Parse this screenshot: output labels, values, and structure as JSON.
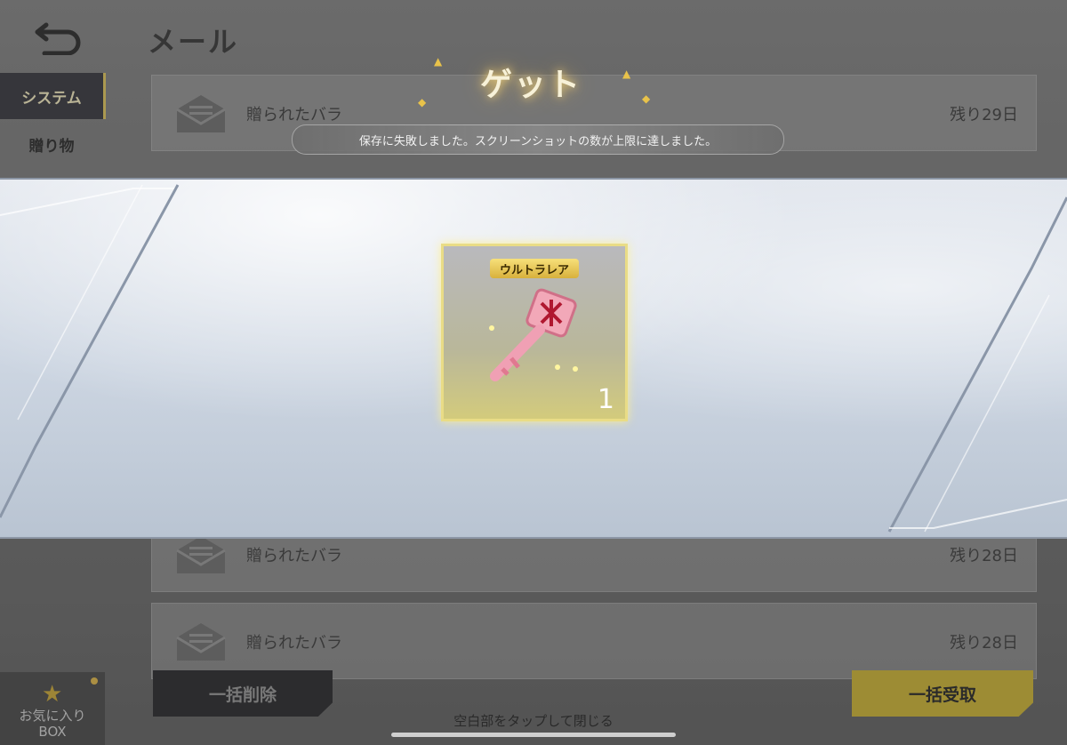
{
  "header": {
    "title": "メール"
  },
  "sidebar": {
    "tabs": [
      {
        "label": "システム",
        "active": true
      },
      {
        "label": "贈り物",
        "active": false
      }
    ],
    "favorite": {
      "line1": "お気に入り",
      "line2": "BOX"
    }
  },
  "mails": [
    {
      "subject": "贈られたバラ",
      "remaining": "残り29日"
    },
    {
      "subject": "贈られたバラ",
      "remaining": "残り28日"
    },
    {
      "subject": "贈られたバラ",
      "remaining": "残り28日"
    }
  ],
  "buttons": {
    "delete_all": "一括削除",
    "receive_all": "一括受取"
  },
  "reward": {
    "title": "ゲット",
    "toast": "保存に失敗しました。スクリーンショットの数が上限に達しました。",
    "item": {
      "rarity": "ウルトラレア",
      "quantity": "1",
      "icon": "pink-key-icon"
    },
    "close_hint": "空白部をタップして閉じる"
  },
  "colors": {
    "accent_gold": "#c9b25a",
    "receive_button": "#b8a338",
    "delete_button": "#2e2e30"
  }
}
